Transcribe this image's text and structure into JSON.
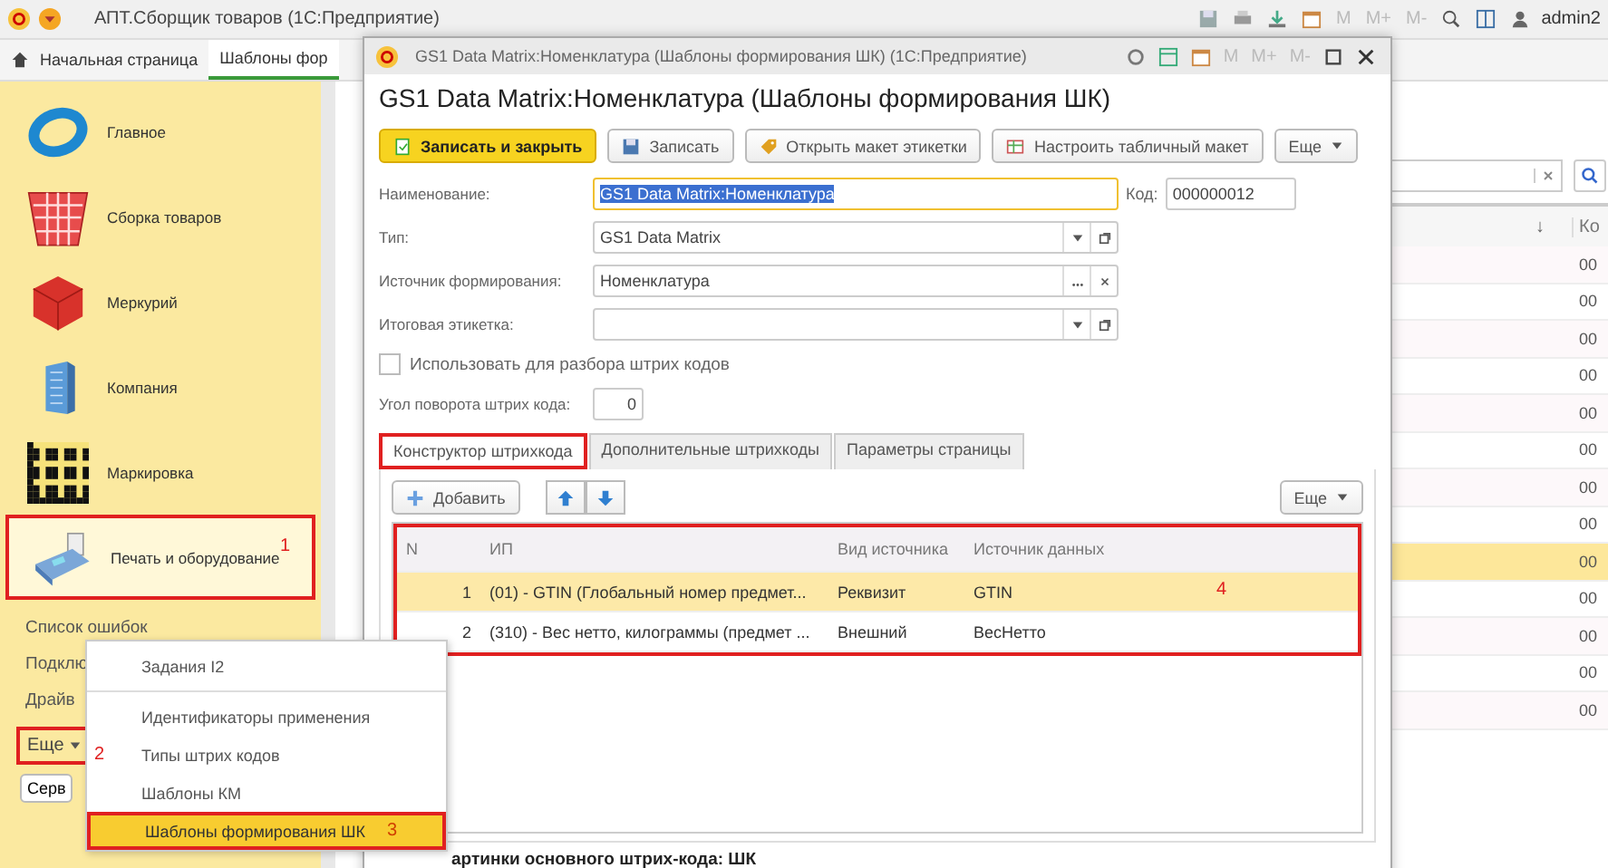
{
  "app_bar": {
    "title": "АПТ.Сборщик товаров (1С:Предприятие)",
    "memory_buttons": [
      "M",
      "M+",
      "M-"
    ],
    "user": "admin2"
  },
  "tabs": [
    {
      "label": "Начальная страница",
      "selected": false
    },
    {
      "label": "Шаблоны фор",
      "selected": true
    }
  ],
  "sidebar": {
    "sections": [
      {
        "label": "Главное",
        "selected": false,
        "highlighted": false
      },
      {
        "label": "Сборка товаров",
        "selected": false,
        "highlighted": false
      },
      {
        "label": "Меркурий",
        "selected": false,
        "highlighted": false
      },
      {
        "label": "Компания",
        "selected": false,
        "highlighted": false
      },
      {
        "label": "Маркировка",
        "selected": false,
        "highlighted": false
      },
      {
        "label": "Печать и оборудование",
        "selected": true,
        "highlighted": true,
        "marker": "1"
      }
    ],
    "links": [
      "Список ошибок",
      "Подклю",
      "Драйв"
    ],
    "more": {
      "label": "Еще",
      "highlighted": true
    },
    "button": "Серв"
  },
  "list": {
    "sort_mark": "↓",
    "code_header": "Ко",
    "rows": [
      {
        "code": "00",
        "selected": false
      },
      {
        "code": "00",
        "selected": false
      },
      {
        "code": "00",
        "selected": false
      },
      {
        "code": "00",
        "selected": false
      },
      {
        "code": "00",
        "selected": false
      },
      {
        "code": "00",
        "selected": false
      },
      {
        "code": "00",
        "selected": false
      },
      {
        "code": "00",
        "selected": false
      },
      {
        "code": "00",
        "selected": true
      },
      {
        "code": "00",
        "selected": false
      },
      {
        "code": "00",
        "selected": false
      },
      {
        "code": "00",
        "selected": false
      },
      {
        "code": "00",
        "selected": false
      }
    ]
  },
  "dialog": {
    "window_title": "GS1 Data Matrix:Номенклатура (Шаблоны формирования ШК) (1С:Предприятие)",
    "memory_buttons": [
      "M",
      "M+",
      "M-"
    ],
    "heading": "GS1 Data Matrix:Номенклатура (Шаблоны формирования ШК)",
    "toolbar": [
      {
        "label": "Записать и закрыть",
        "kind": "primary"
      },
      {
        "label": "Записать",
        "kind": "save"
      },
      {
        "label": "Открыть макет этикетки",
        "kind": "tag"
      },
      {
        "label": "Настроить табличный макет",
        "kind": "table"
      },
      {
        "label": "Еще",
        "kind": "more"
      }
    ],
    "name": {
      "label": "Наименование:",
      "value": "GS1 Data Matrix:Номенклатура"
    },
    "code": {
      "label": "Код:",
      "value": "000000012"
    },
    "fields": [
      {
        "label": "Тип:",
        "value": "GS1 Data Matrix",
        "kind": "select"
      },
      {
        "label": "Источник формирования:",
        "value": "Номенклатура",
        "kind": "choice"
      },
      {
        "label": "Итоговая этикетка:",
        "kind": "select"
      }
    ],
    "checkbox": {
      "label": "Использовать для разбора штрих кодов",
      "checked": false
    },
    "angle": {
      "label": "Угол поворота штрих кода:",
      "value": "0"
    },
    "tabs": [
      {
        "label": "Конструктор штрихкода",
        "selected": true,
        "highlighted": true
      },
      {
        "label": "Дополнительные штрихкоды",
        "selected": false,
        "highlighted": false
      },
      {
        "label": "Параметры страницы",
        "selected": false,
        "highlighted": false
      }
    ],
    "add_button": "Добавить",
    "more_button": "Еще",
    "table": {
      "columns": [
        "N",
        "ИП",
        "Вид источника",
        "Источник данных"
      ],
      "marker": "4",
      "rows": [
        {
          "n": "1",
          "ip": "(01) - GTIN (Глобальный номер предмет...",
          "source_kind": "Реквизит",
          "source": "GTIN",
          "selected": true
        },
        {
          "n": "2",
          "ip": "(310) - Вес нетто, килограммы (предмет ...",
          "source_kind": "Внешний",
          "source": "ВесНетто",
          "selected": false
        }
      ]
    },
    "footer": "артинки основного штрих-кода: ШК"
  },
  "menu": {
    "items": [
      {
        "label": "Задания I2",
        "selected": false,
        "highlighted": false
      },
      {
        "label": "Идентификаторы применения",
        "selected": false,
        "highlighted": false
      },
      {
        "label": "Типы штрих кодов",
        "selected": false,
        "highlighted": false,
        "marker": "2"
      },
      {
        "label": "Шаблоны КМ",
        "selected": false,
        "highlighted": false
      },
      {
        "label": "Шаблоны формирования ШК",
        "selected": true,
        "highlighted": true,
        "marker": "3"
      }
    ]
  }
}
